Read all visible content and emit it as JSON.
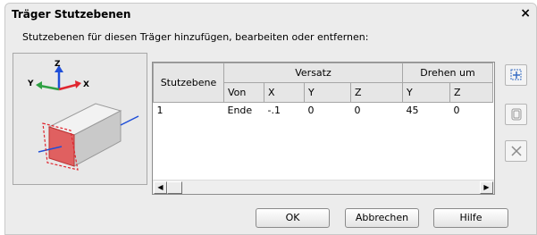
{
  "window": {
    "title": "Träger Stutzebenen",
    "close_glyph": "×"
  },
  "instruction": "Stutzebenen für diesen Träger hinzufügen, bearbeiten oder entfernen:",
  "preview": {
    "axis_labels": {
      "z": "Z",
      "y": "Y",
      "x": "X"
    },
    "colors": {
      "axis_x": "#e0262f",
      "axis_y": "#2ea043",
      "axis_z": "#1f4fd8",
      "cut_plane": "#e0262f"
    }
  },
  "grid": {
    "group_headers": {
      "stutzebene": "Stutzebene",
      "versatz": "Versatz",
      "drehen_um": "Drehen um"
    },
    "sub_headers": {
      "von": "Von",
      "x": "X",
      "y": "Y",
      "z": "Z",
      "rot_y": "Y",
      "rot_z": "Z"
    },
    "rows": [
      {
        "stutzebene": "1",
        "von": "Ende",
        "x": "-.1",
        "y": "0",
        "z": "0",
        "rot_y": "45",
        "rot_z": "0"
      }
    ]
  },
  "side_buttons": {
    "add": "add-plane-icon",
    "edit": "edit-plane-icon",
    "remove": "delete-icon"
  },
  "buttons": {
    "ok": "OK",
    "cancel": "Abbrechen",
    "help": "Hilfe"
  }
}
